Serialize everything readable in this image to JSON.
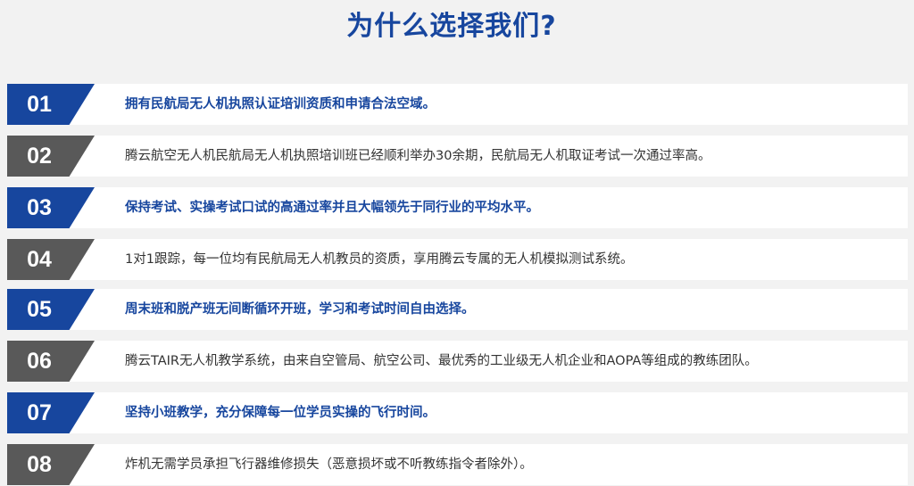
{
  "page": {
    "title": "为什么选择我们?"
  },
  "colors": {
    "accent_blue": "#17469e",
    "accent_gray": "#595959",
    "background": "#f2f2f2"
  },
  "items": [
    {
      "number": "01",
      "text": "拥有民航局无人机执照认证培训资质和申请合法空域。"
    },
    {
      "number": "02",
      "text": "腾云航空无人机民航局无人机执照培训班已经顺利举办30余期，民航局无人机取证考试一次通过率高。"
    },
    {
      "number": "03",
      "text": "保持考试、实操考试口试的高通过率并且大幅领先于同行业的平均水平。"
    },
    {
      "number": "04",
      "text": "1对1跟踪，每一位均有民航局无人机教员的资质，享用腾云专属的无人机模拟测试系统。"
    },
    {
      "number": "05",
      "text": "周末班和脱产班无间断循环开班，学习和考试时间自由选择。"
    },
    {
      "number": "06",
      "text": "腾云TAIR无人机教学系统，由来自空管局、航空公司、最优秀的工业级无人机企业和AOPA等组成的教练团队。"
    },
    {
      "number": "07",
      "text": "坚持小班教学，充分保障每一位学员实操的飞行时间。"
    },
    {
      "number": "08",
      "text": "炸机无需学员承担飞行器维修损失（恶意损坏或不听教练指令者除外）。"
    }
  ]
}
